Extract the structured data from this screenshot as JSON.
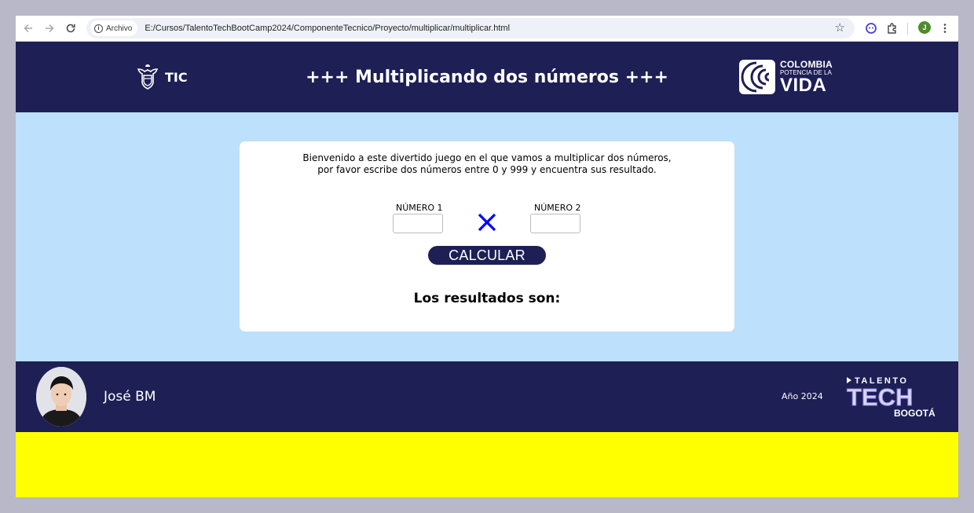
{
  "browser": {
    "back_icon": "arrow-left-icon",
    "forward_icon": "arrow-right-icon",
    "reload_icon": "reload-icon",
    "security_chip": "Archivo",
    "url": "E:/Cursos/TalentoTechBootCamp2024/ComponenteTecnico/Proyecto/multiplicar/multiplicar.html",
    "profile_initial": "J"
  },
  "header": {
    "logo_text": "TIC",
    "title": "+++ Multiplicando dos números +++",
    "brand_line1": "COLOMBIA",
    "brand_line2": "POTENCIA DE LA",
    "brand_line3": "VIDA"
  },
  "card": {
    "intro_line1": "Bienvenido a este divertido juego en el que vamos a multiplicar dos números,",
    "intro_line2": "por favor escribe dos números entre 0 y 999 y encuentra sus resultado.",
    "label_num1": "NÚMERO 1",
    "label_num2": "NÚMERO 2",
    "num1_value": "",
    "num2_value": "",
    "operator_icon": "multiply-icon",
    "operator_color": "#0000ff",
    "calc_button": "CALCULAR",
    "results_title": "Los resultados son:"
  },
  "footer": {
    "author": "José BM",
    "year": "Año 2024",
    "logo_line1": "TALENTO",
    "logo_line2": "TECH",
    "logo_line3": "BOGOTÁ"
  },
  "colors": {
    "navy": "#1d1f55",
    "light_blue": "#bde0fd",
    "yellow": "#ffff00",
    "outer_frame": "#b9b8c8"
  }
}
